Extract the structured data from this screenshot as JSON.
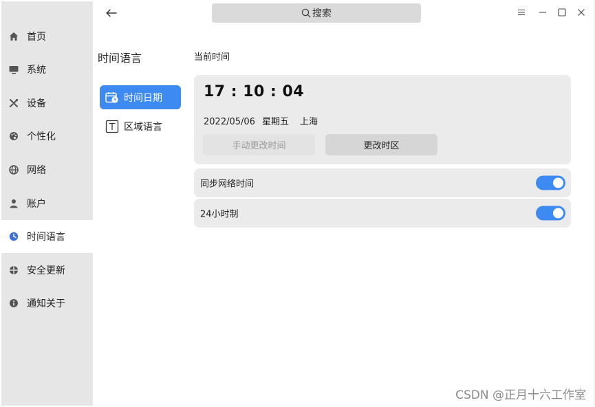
{
  "header": {
    "search_placeholder": "搜索"
  },
  "sidebar": {
    "items": [
      {
        "label": "首页",
        "icon": "home-icon"
      },
      {
        "label": "系统",
        "icon": "monitor-icon"
      },
      {
        "label": "设备",
        "icon": "tools-icon"
      },
      {
        "label": "个性化",
        "icon": "palette-icon"
      },
      {
        "label": "网络",
        "icon": "globe-icon"
      },
      {
        "label": "账户",
        "icon": "user-icon"
      },
      {
        "label": "时间语言",
        "icon": "clock-icon",
        "active": true
      },
      {
        "label": "安全更新",
        "icon": "shield-icon"
      },
      {
        "label": "通知关于",
        "icon": "info-icon"
      }
    ]
  },
  "subnav": {
    "title": "时间语言",
    "items": [
      {
        "label": "时间日期",
        "icon": "calendar-clock-icon",
        "active": true
      },
      {
        "label": "区域语言",
        "icon": "region-language-icon"
      }
    ]
  },
  "main": {
    "current_time_label": "当前时间",
    "clock": "17 : 10 : 04",
    "date": "2022/05/06",
    "weekday": "星期五",
    "timezone_city": "上海",
    "manual_change_time_label": "手动更改时间",
    "change_timezone_label": "更改时区",
    "toggles": [
      {
        "label": "同步网络时间",
        "on": true
      },
      {
        "label": "24小时制",
        "on": true
      }
    ]
  },
  "watermark": "CSDN @正月十六工作室",
  "colors": {
    "accent": "#3d8bf2",
    "sidebar_bg": "#e6e6e6",
    "card_bg": "#ebebeb"
  }
}
